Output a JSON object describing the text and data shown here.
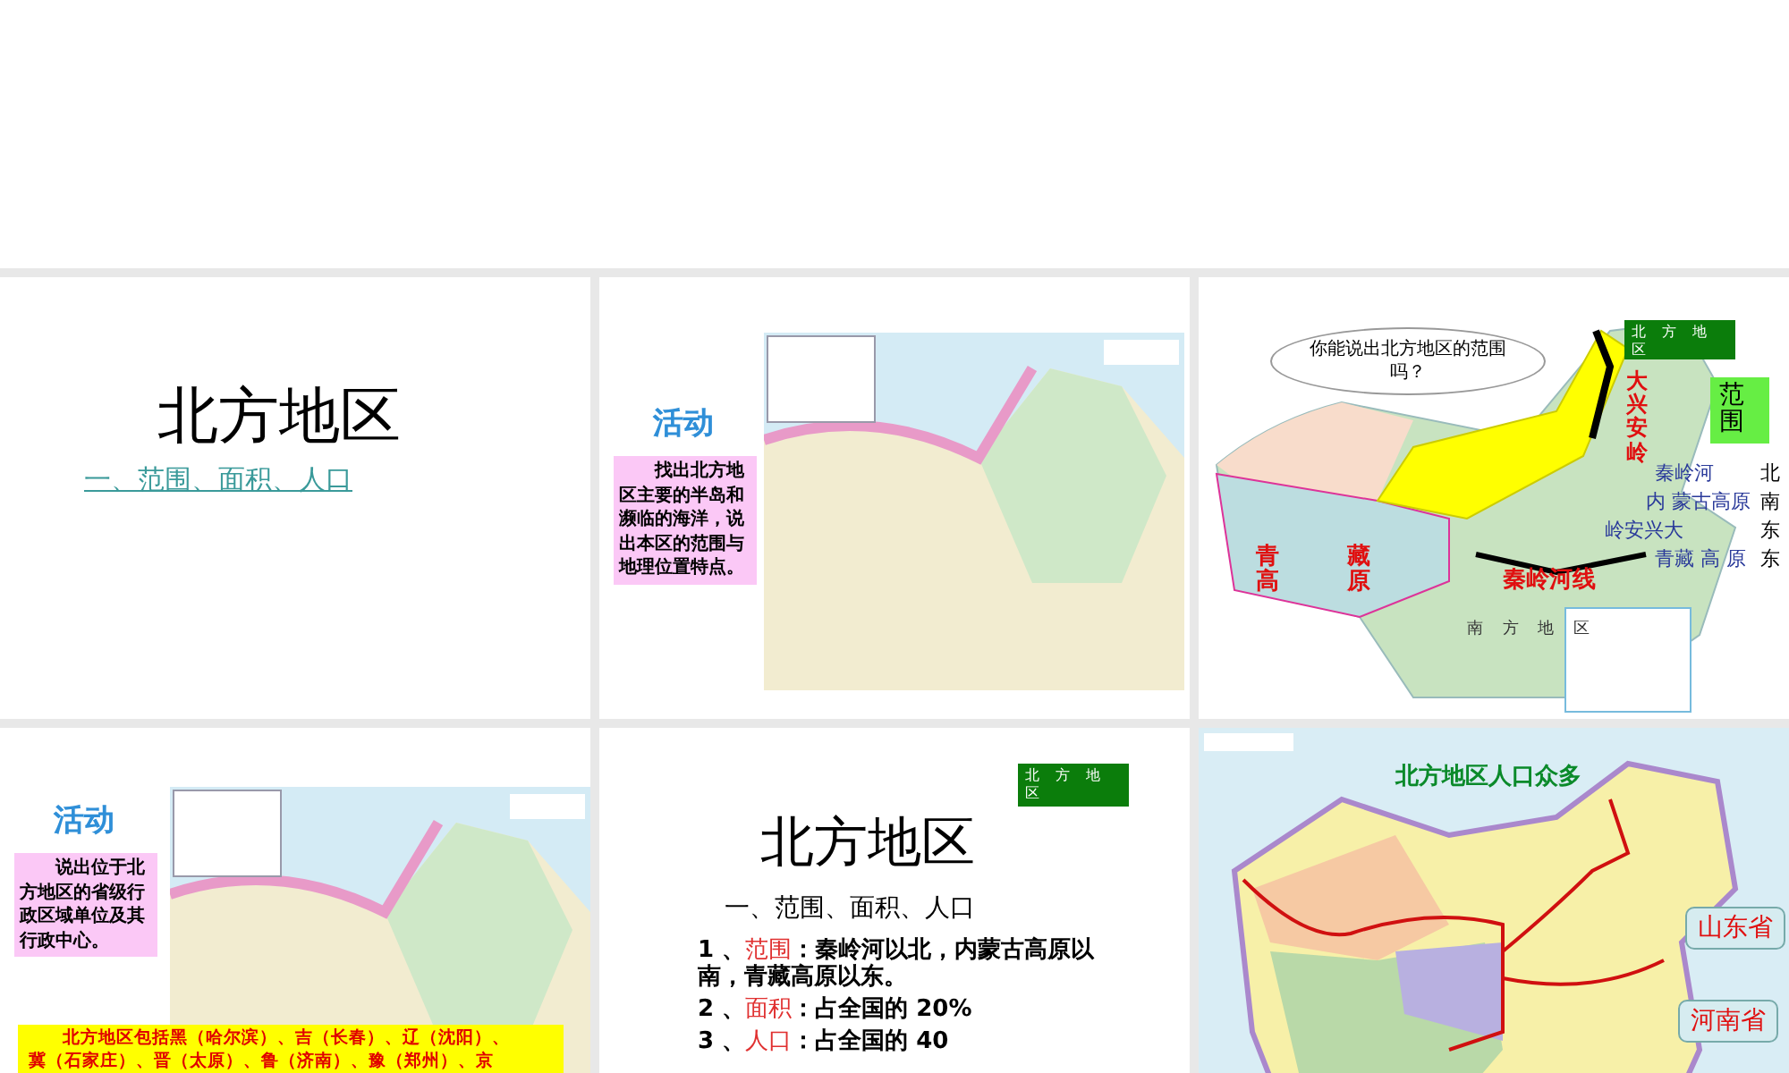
{
  "slides": [
    {
      "kind": "title",
      "title": "北方地区",
      "link": "一、范围、面积、人口"
    },
    {
      "kind": "activity",
      "heading": "活动",
      "note": "找出北方地区主要的半岛和濒临的海洋，说出本区的范围与地理位置特点。"
    },
    {
      "kind": "range_map",
      "bubble": "你能说出北方地区的范围吗？",
      "tag": "北方地区",
      "side_label": "范围",
      "map_labels": [
        "大兴安岭",
        "青高",
        "藏原",
        "秦岭河线",
        "南 方 地 区"
      ],
      "rows": [
        {
          "text": "秦岭河",
          "dir": "北"
        },
        {
          "text": "内 蒙古高原",
          "dir": "南"
        },
        {
          "text": "岭安兴大",
          "dir": "东"
        },
        {
          "text": "青藏 高 原",
          "dir": "东"
        }
      ]
    },
    {
      "kind": "activity",
      "heading": "活动",
      "note": "说出位于北方地区的省级行政区域单位及其行政中心。",
      "banner": [
        "北方地区包括黑（哈尔滨）、吉（长春）、辽（沈阳）、",
        "冀（石家庄）、晋（太原）、鲁（济南）、豫（郑州）、京"
      ]
    },
    {
      "kind": "outline",
      "tag": "北方地区",
      "title": "北方地区",
      "subtitle": "一、范围、面积、人口",
      "items": [
        {
          "num": "1 、",
          "term": "范围",
          "text": "：秦岭河以北，内蒙古高原以南，青藏高原以东。"
        },
        {
          "num": "2 、",
          "term": "面积",
          "text": "：占全国的 20%"
        },
        {
          "num": "3 、",
          "term": "人口",
          "text": "：占全国的 40"
        }
      ]
    },
    {
      "kind": "population_map",
      "title": "北方地区人口众多",
      "callouts": [
        "山东省",
        "河南省"
      ]
    }
  ]
}
